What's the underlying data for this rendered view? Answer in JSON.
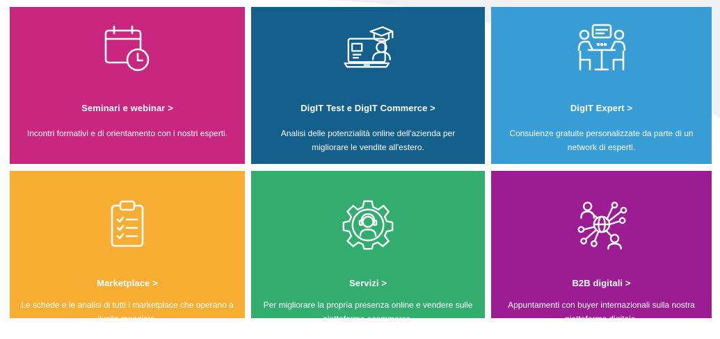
{
  "colors": {
    "magenta": "#c8267f",
    "dark_blue": "#155f8c",
    "light_blue": "#389dd4",
    "orange": "#f7ae33",
    "green": "#33ad6e",
    "purple": "#9b1c93"
  },
  "tiles": [
    {
      "icon": "calendar-clock-icon",
      "title": "Seminari e webinar >",
      "desc": "Incontri formativi e di orientamento con i nostri esperti."
    },
    {
      "icon": "laptop-graduation-icon",
      "title": "DigIT Test e DigIT Commerce >",
      "desc": "Analisi delle potenzialità online dell'azienda per migliorare le vendite all'estero."
    },
    {
      "icon": "consultation-meeting-icon",
      "title": "DigIT Expert >",
      "desc": "Consulenze gratuite personalizzate da parte di un network di esperti."
    },
    {
      "icon": "clipboard-checklist-icon",
      "title": "Marketplace >",
      "desc": "Le schede e le analisi di tutti i marketplace che operano a livello mondiale."
    },
    {
      "icon": "gear-support-agent-icon",
      "title": "Servizi >",
      "desc": "Per migliorare la propria presenza online e vendere sulle piattaforme ecommerce."
    },
    {
      "icon": "global-network-people-icon",
      "title": "B2B digitali >",
      "desc": "Appuntamenti con buyer internazionali sulla nostra piattaforma digitale."
    }
  ]
}
